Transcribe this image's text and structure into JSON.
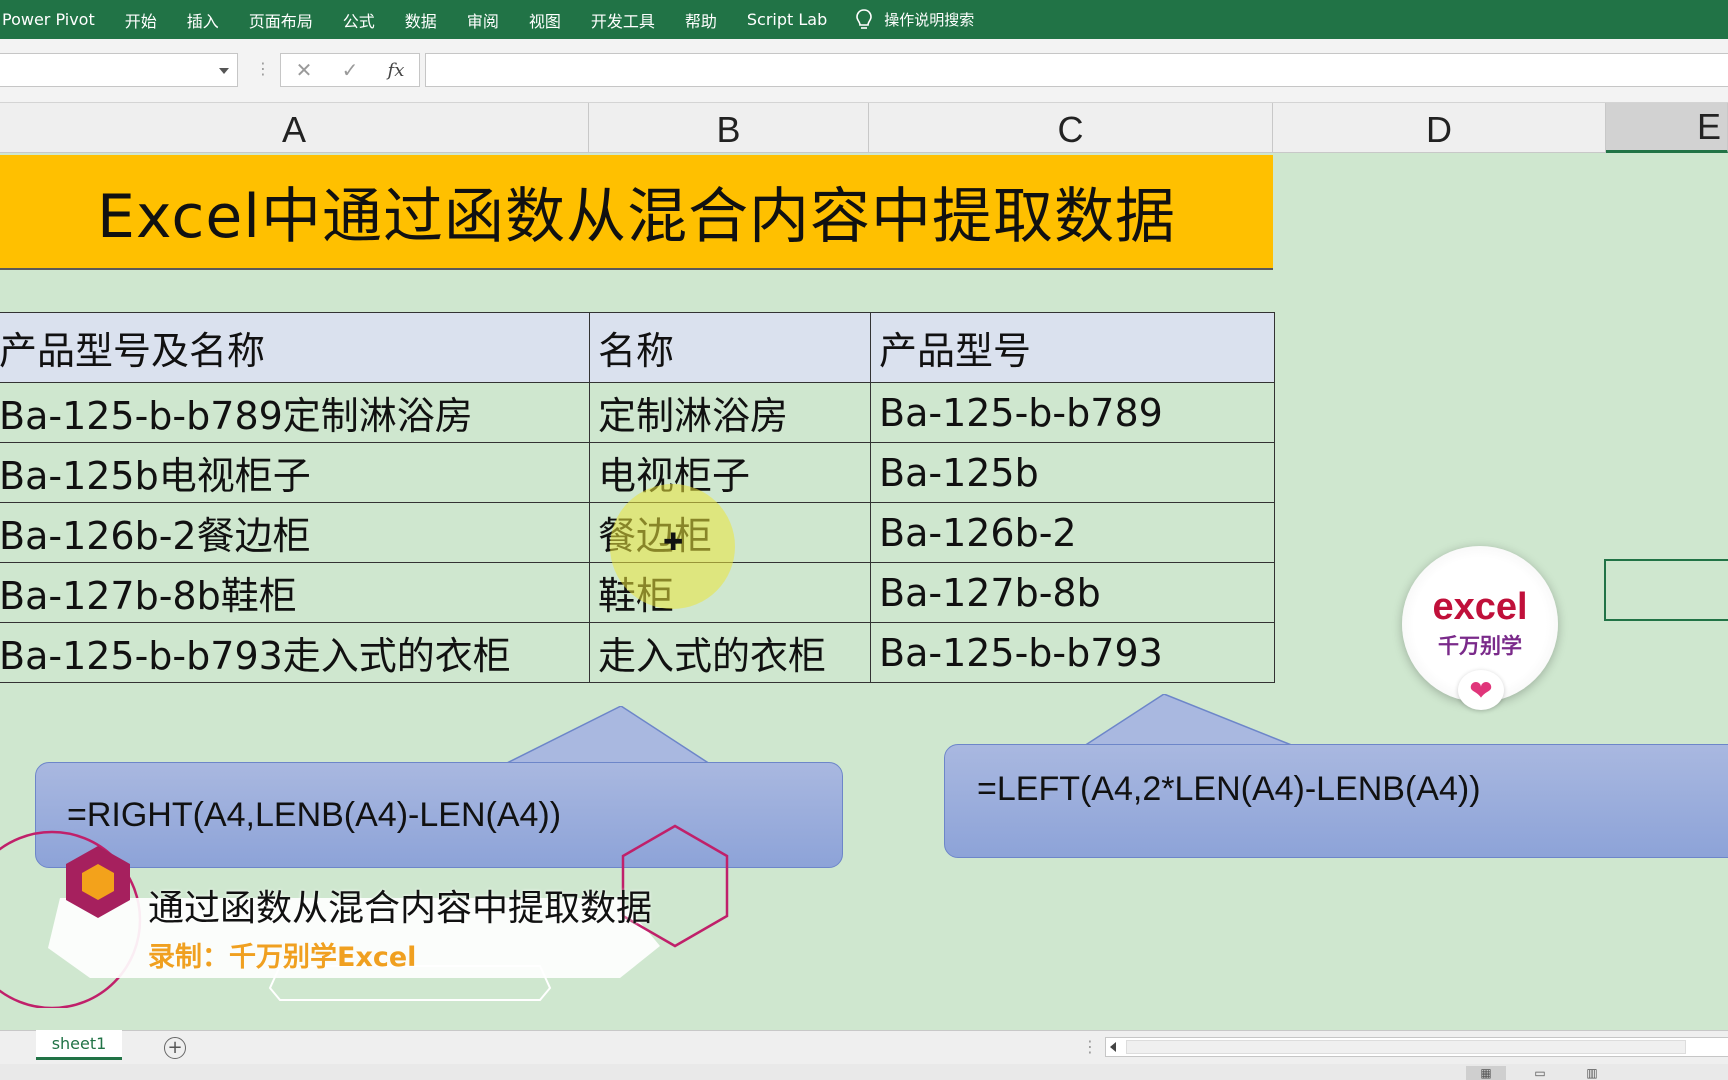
{
  "ribbon": {
    "menu": [
      "Power Pivot",
      "开始",
      "插入",
      "页面布局",
      "公式",
      "数据",
      "审阅",
      "视图",
      "开发工具",
      "帮助",
      "Script Lab"
    ],
    "tell_me": "操作说明搜索"
  },
  "formula_bar": {
    "name_box": "",
    "cancel": "✕",
    "enter": "✓",
    "fx": "fx",
    "value": ""
  },
  "columns": [
    "A",
    "B",
    "C",
    "D",
    "E"
  ],
  "sheet": {
    "title": "Excel中通过函数从混合内容中提取数据",
    "table": {
      "headers": [
        "产品型号及名称",
        "名称",
        "产品型号"
      ],
      "rows": [
        [
          "Ba-125-b-b789定制淋浴房",
          "定制淋浴房",
          "Ba-125-b-b789"
        ],
        [
          "Ba-125b电视柜子",
          "电视柜子",
          "Ba-125b"
        ],
        [
          "Ba-126b-2餐边柜",
          "餐边柜",
          "Ba-126b-2"
        ],
        [
          "Ba-127b-8b鞋柜",
          "鞋柜",
          "Ba-127b-8b"
        ],
        [
          "Ba-125-b-b793走入式的衣柜",
          "走入式的衣柜",
          "Ba-125-b-b793"
        ]
      ]
    },
    "callout_left": "=RIGHT(A4,LENB(A4)-LEN(A4))",
    "callout_right": "=LEFT(A4,2*LEN(A4)-LENB(A4))"
  },
  "badge": {
    "title": "excel",
    "subtitle": "千万别学",
    "icon": "heart-icon"
  },
  "lower_third": {
    "main": "通过函数从混合内容中提取数据",
    "sub": "录制：千万别学Excel"
  },
  "sheet_tabs": {
    "tabs": [
      "sheet1"
    ],
    "add": "+"
  },
  "colors": {
    "ribbon": "#217346",
    "title_band": "#ffc000",
    "sheet_bg": "#cfe7cf",
    "table_header": "#dae1ee",
    "callout": "#8da3d8",
    "badge_text": "#c0103a",
    "lower_third_sub": "#f0a020"
  }
}
